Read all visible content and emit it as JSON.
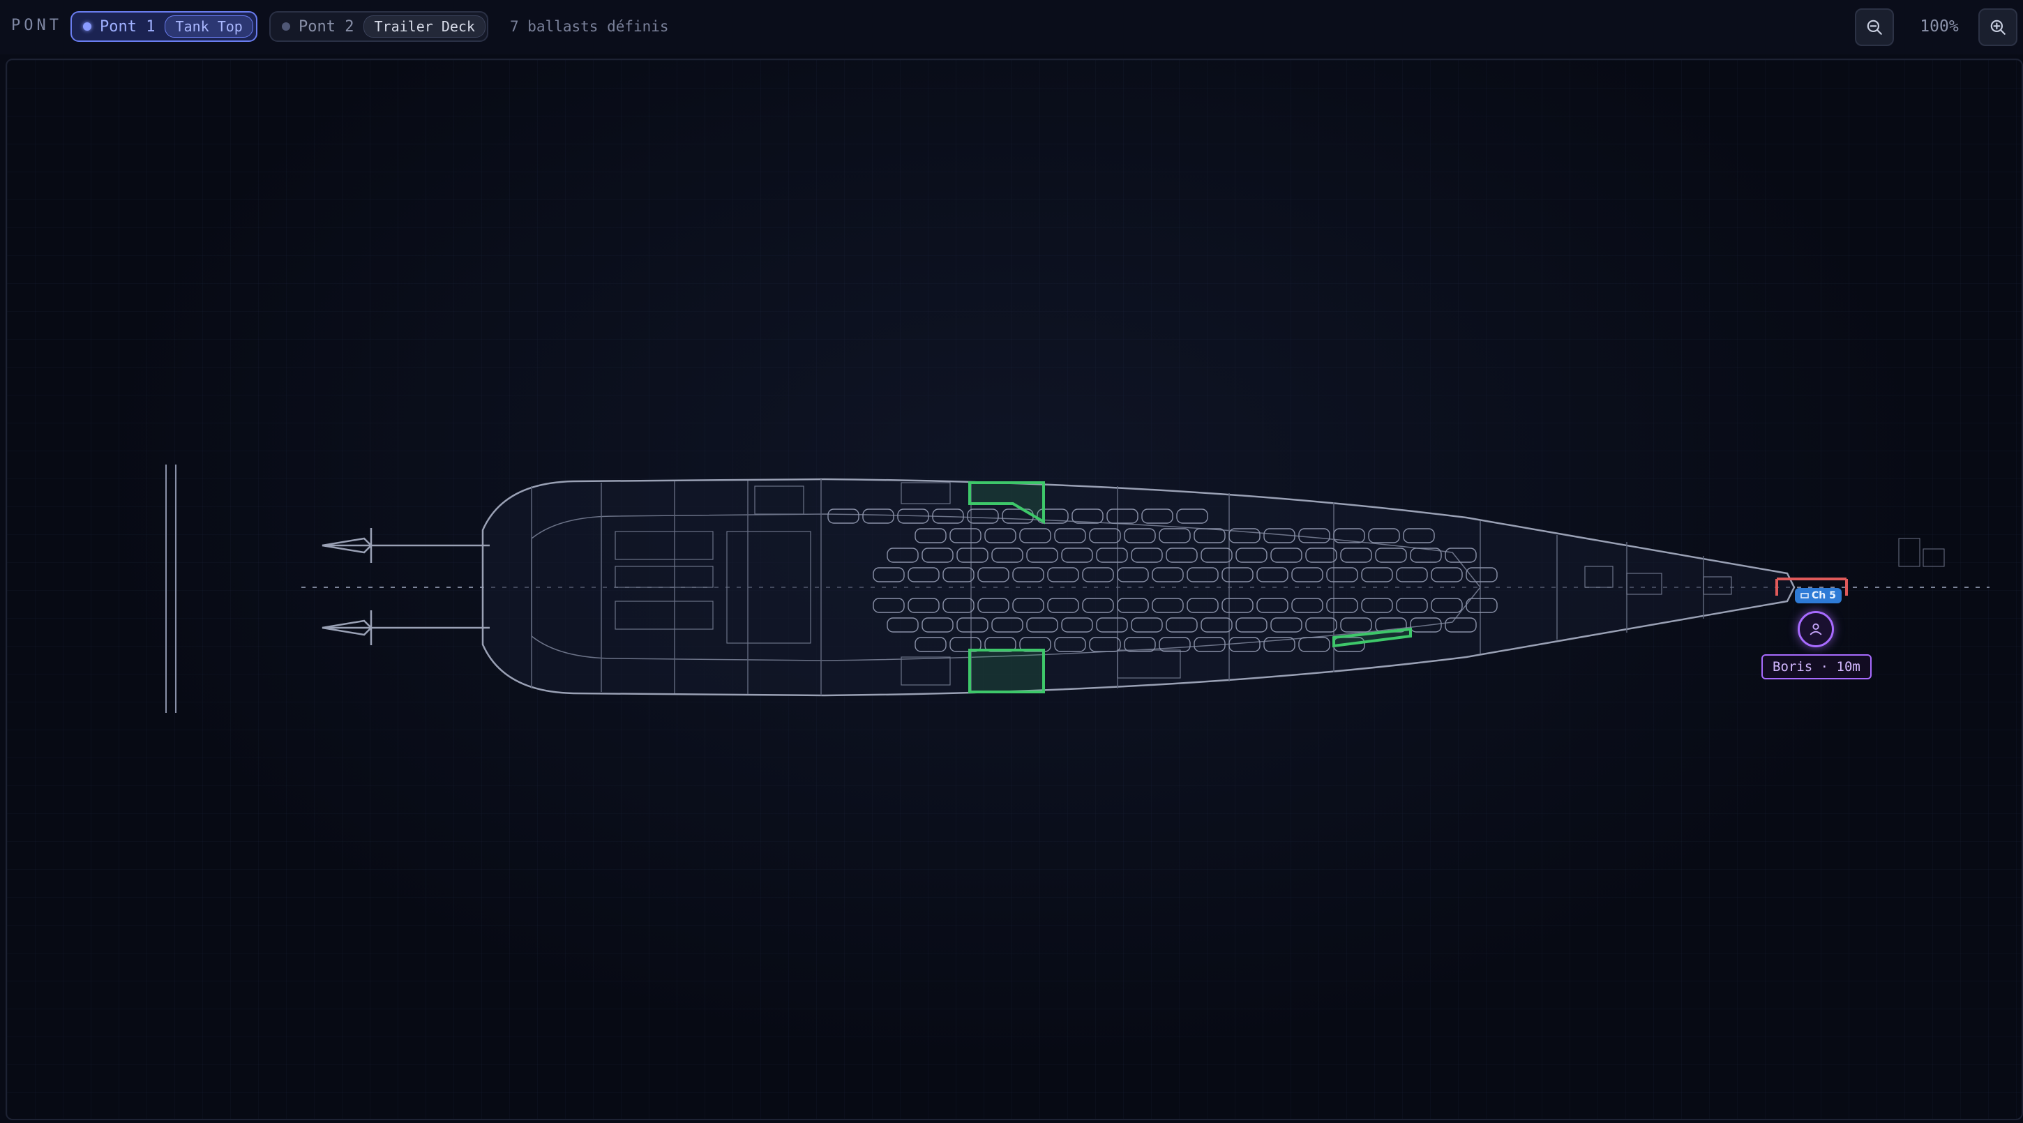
{
  "toolbar": {
    "deck_label": "PONT",
    "decks": [
      {
        "name": "Pont 1",
        "tag": "Tank Top",
        "active": true
      },
      {
        "name": "Pont 2",
        "tag": "Trailer Deck",
        "active": false
      }
    ],
    "ballast_count": "7 ballasts définis",
    "zoom_level": "100%"
  },
  "crew_marker": {
    "badge": "Ch 5",
    "label": "Boris · 10m",
    "icon": "person-icon"
  },
  "icons": {
    "zoom_out": "zoom-out-icon",
    "zoom_in": "zoom-in-icon",
    "badge": "door-icon"
  },
  "colors": {
    "active_tab": "#6a7df0",
    "ballast_highlight": "#3ec86a",
    "crew_accent": "#a86bff",
    "badge_blue": "#2e7bd6",
    "alert_red": "#e05a5a"
  }
}
